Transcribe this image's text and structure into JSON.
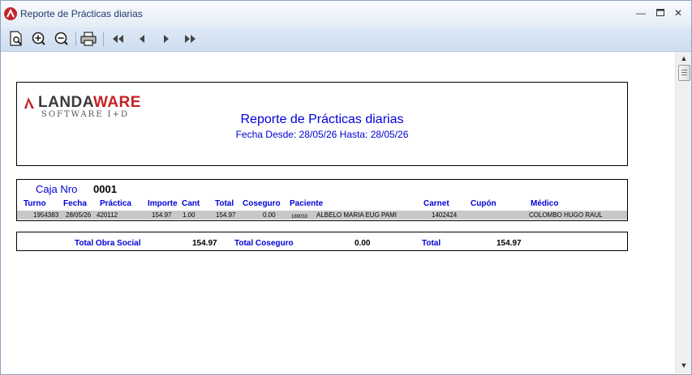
{
  "window": {
    "title": "Reporte de Prácticas diarias"
  },
  "toolbar": {
    "buttons": [
      "print-preview-icon",
      "zoom-in-icon",
      "zoom-out-icon",
      "printer-icon",
      "first-page-icon",
      "previous-page-icon",
      "next-page-icon",
      "last-page-icon"
    ]
  },
  "report": {
    "logo": {
      "main_a": "LANDA",
      "main_b": "WARE",
      "sub": "SOFTWARE I+D"
    },
    "title": "Reporte de Prácticas diarias",
    "subtitle": "Fecha Desde: 28/05/26 Hasta: 28/05/26",
    "caja": {
      "label": "Caja Nro",
      "value": "0001"
    },
    "headers": {
      "turno": "Turno",
      "fecha": "Fecha",
      "practica": "Práctica",
      "importe": "Importe",
      "cant": "Cant",
      "total": "Total",
      "coseguro": "Coseguro",
      "paciente": "Paciente",
      "carnet": "Carnet",
      "cupon": "Cupón",
      "medico": "Médico"
    },
    "rows": [
      {
        "turno": "1954383",
        "fecha": "28/05/26",
        "practica": "420112",
        "importe": "154.97",
        "cant": "1.00",
        "total": "154.97",
        "coseguro": "0.00",
        "paciente_id": "189033",
        "paciente": "ALBELO MARIA EUG  PAMI",
        "carnet": "1402424",
        "cupon": "",
        "medico": "COLOMBO HUGO RAUL"
      }
    ],
    "totals": {
      "obra_social_label": "Total Obra Social",
      "obra_social_value": "154.97",
      "coseguro_label": "Total Coseguro",
      "coseguro_value": "0.00",
      "total_label": "Total",
      "total_value": "154.97"
    }
  },
  "colors": {
    "report_blue": "#0000d6",
    "row_gray": "#c8c8c8",
    "logo_red": "#c62127"
  }
}
